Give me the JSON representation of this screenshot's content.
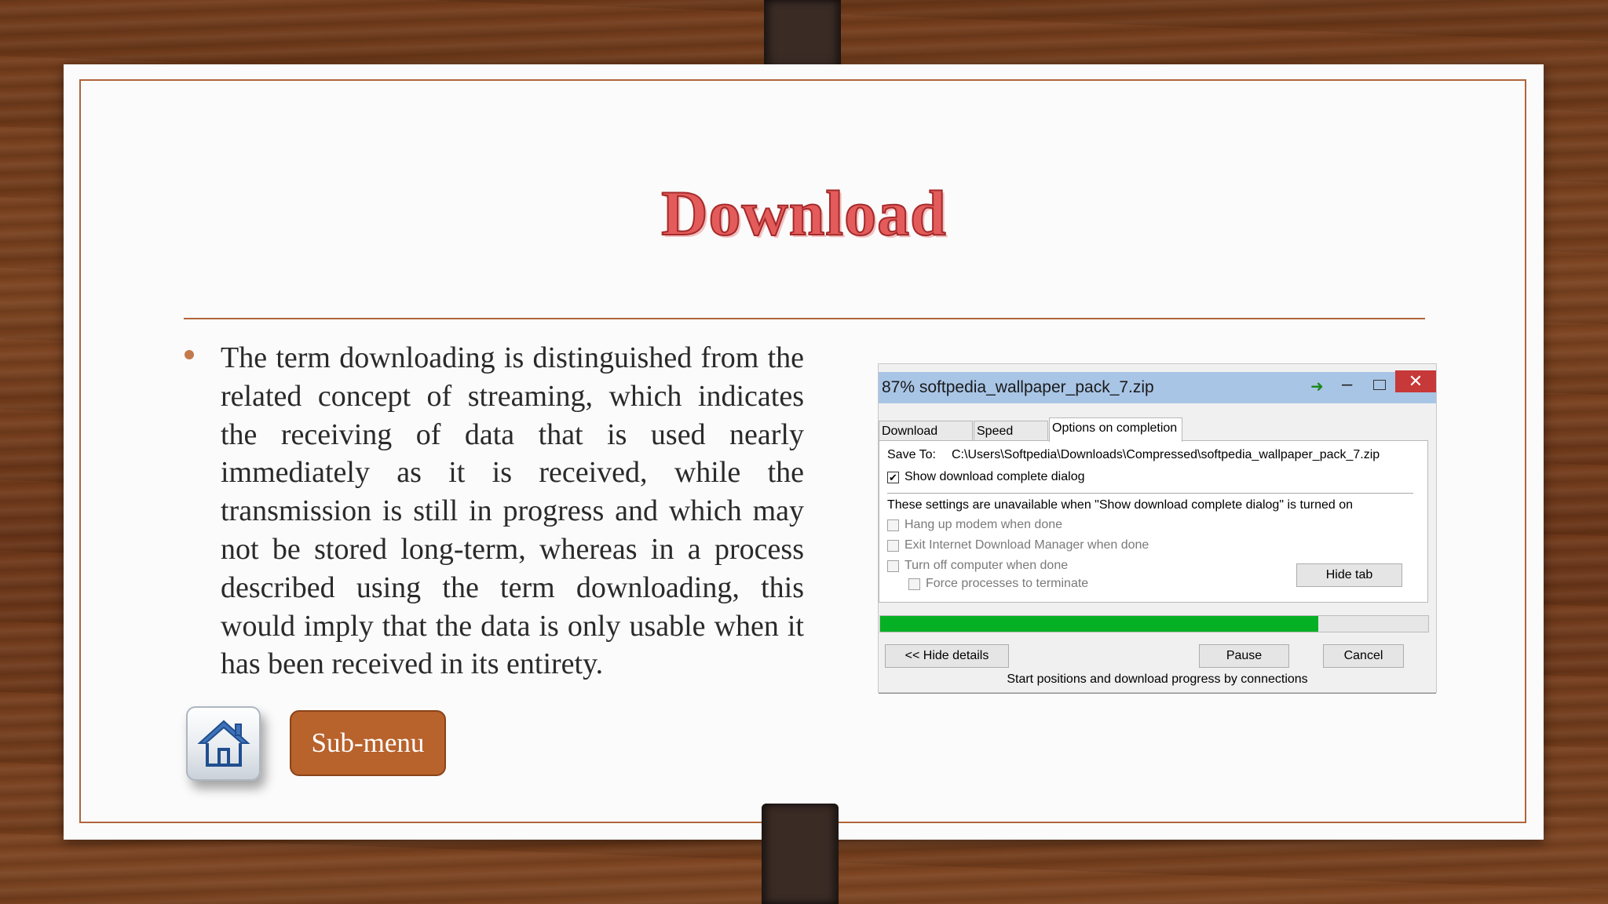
{
  "slide": {
    "title": "Download",
    "bullet_text": "The term downloading is distinguished from the related concept of streaming, which indicates the receiving of data that is used nearly immediately as it is received, while the transmission is still in progress and which may not be stored long-term, whereas in a process described using the term downloading, this would imply that the data is only usable when it has been received in its entirety.",
    "submenu_label": "Sub-menu",
    "home_icon": "home-icon"
  },
  "dialog": {
    "title": "87% softpedia_wallpaper_pack_7.zip",
    "tabs": [
      "Download status",
      "Speed Limiter",
      "Options on completion"
    ],
    "active_tab": 2,
    "save_to_label": "Save To:",
    "save_to_path": "C:\\Users\\Softpedia\\Downloads\\Compressed\\softpedia_wallpaper_pack_7.zip",
    "show_dialog_label": "Show download complete dialog",
    "show_dialog_checked": true,
    "settings_note": "These settings are unavailable when \"Show download complete dialog\" is turned on",
    "options": [
      {
        "label": "Hang up modem when done",
        "checked": false
      },
      {
        "label": "Exit Internet Download Manager when done",
        "checked": false
      },
      {
        "label": "Turn off computer when done",
        "checked": false
      },
      {
        "label": "Force processes to terminate",
        "checked": false
      }
    ],
    "hide_tab_label": "Hide tab",
    "progress_fraction": 0.8,
    "hide_details_label": "<< Hide details",
    "pause_label": "Pause",
    "cancel_label": "Cancel",
    "status_text": "Start positions and download progress by connections",
    "close_glyph": "✕",
    "minimize_glyph": "–"
  },
  "colors": {
    "title_red": "#e35b5b",
    "accent_brown": "#b0653a",
    "submenu_bg": "#b8622c",
    "progress_green": "#06b025",
    "close_red": "#c73838"
  }
}
